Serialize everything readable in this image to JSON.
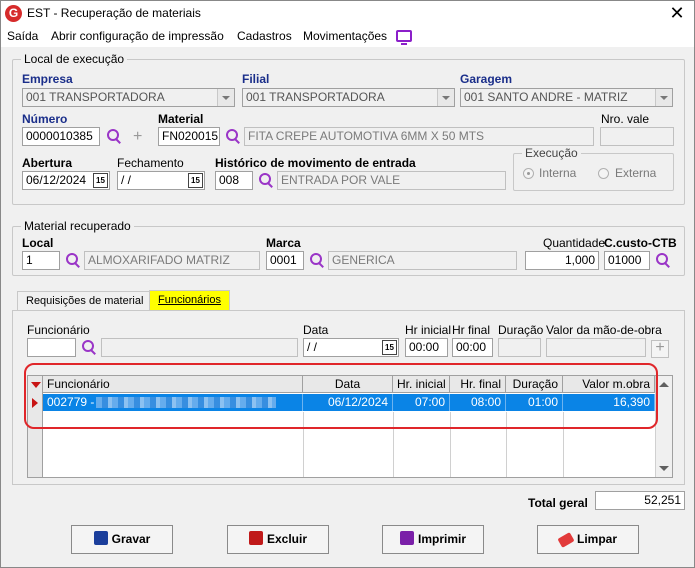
{
  "window": {
    "title": "EST - Recuperação de materiais",
    "app_icon_letter": "G",
    "close_glyph": "✕"
  },
  "menu": [
    "Saída",
    "Abrir configuração de impressão",
    "Cadastros",
    "Movimentações"
  ],
  "local_execucao": {
    "group_title": "Local de execução",
    "empresa_label": "Empresa",
    "empresa_value": "001 TRANSPORTADORA",
    "filial_label": "Filial",
    "filial_value": "001 TRANSPORTADORA",
    "garagem_label": "Garagem",
    "garagem_value": "001 SANTO ANDRE - MATRIZ",
    "numero_label": "Número",
    "numero_value": "0000010385",
    "material_label": "Material",
    "material_code": "FN020015",
    "material_desc": "FITA CREPE AUTOMOTIVA 6MM X 50 MTS",
    "nro_vale_label": "Nro. vale",
    "nro_vale_value": "",
    "abertura_label": "Abertura",
    "abertura_value": "06/12/2024",
    "fechamento_label": "Fechamento",
    "fechamento_value": " /  /",
    "historico_label": "Histórico de movimento de entrada",
    "historico_code": "008",
    "historico_desc": "ENTRADA POR VALE",
    "execucao_title": "Execução",
    "execucao_options": [
      "Interna",
      "Externa"
    ],
    "execucao_selected": "Interna",
    "calendar_glyph": "15"
  },
  "material_recuperado": {
    "group_title": "Material recuperado",
    "local_label": "Local",
    "local_code": "1",
    "local_desc": "ALMOXARIFADO MATRIZ",
    "marca_label": "Marca",
    "marca_code": "0001",
    "marca_desc": "GENERICA",
    "quantidade_label": "Quantidade",
    "quantidade_value": "1,000",
    "ccusto_label": "C.custo-CTB",
    "ccusto_value": "01000"
  },
  "tabs": [
    {
      "label": "Requisições de material",
      "active": false
    },
    {
      "label": "Funcionários",
      "active": true
    }
  ],
  "funcionarios_form": {
    "funcionario_label": "Funcionário",
    "funcionario_code": "",
    "funcionario_name": "",
    "data_label": "Data",
    "data_value": " /  /",
    "hr_inicial_label": "Hr inicial",
    "hr_inicial_value": "00:00",
    "hr_final_label": "Hr final",
    "hr_final_value": "00:00",
    "duracao_label": "Duração",
    "duracao_value": "",
    "valor_label": "Valor da mão-de-obra",
    "valor_value": "",
    "add_glyph": "+"
  },
  "grid": {
    "columns": [
      "Funcionário",
      "Data",
      "Hr. inicial",
      "Hr. final",
      "Duração",
      "Valor m.obra"
    ],
    "rows": [
      {
        "funcionario": "002779 -",
        "data": "06/12/2024",
        "hr_inicial": "07:00",
        "hr_final": "08:00",
        "duracao": "01:00",
        "valor": "16,390"
      }
    ]
  },
  "total_geral_label": "Total geral",
  "total_geral_value": "52,251",
  "buttons": {
    "gravar": "Gravar",
    "excluir": "Excluir",
    "imprimir": "Imprimir",
    "limpar": "Limpar"
  }
}
